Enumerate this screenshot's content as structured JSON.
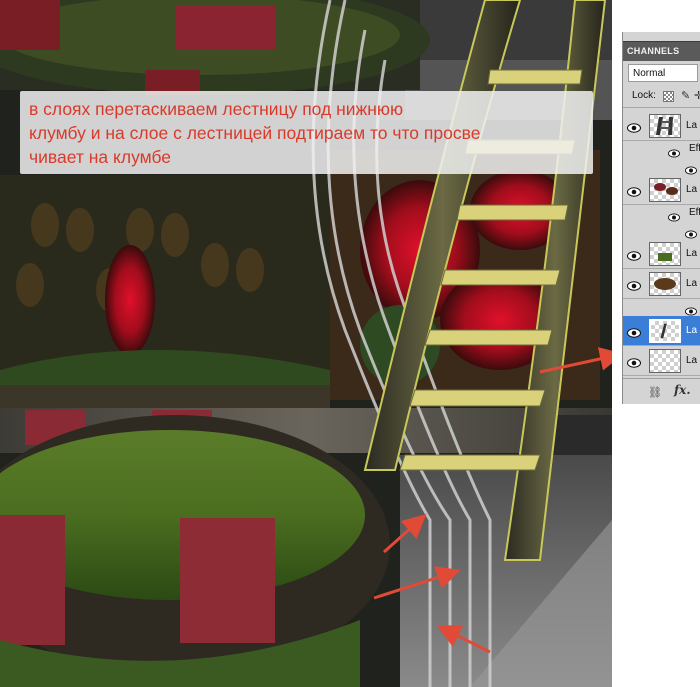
{
  "annotation": {
    "text": "в слоях перетаскиваем лестницу под нижнюю\nклумбу и на слое с лестницей подтираем то что просве\nчивает на клумбе"
  },
  "layers_panel": {
    "tab_label": "CHANNELS",
    "blend_mode": "Normal",
    "lock_label": "Lock:",
    "rows": [
      {
        "kind": "layer",
        "name": "La",
        "visible": true,
        "selected": false,
        "thumb": "ladder"
      },
      {
        "kind": "effects",
        "name": "Effe"
      },
      {
        "kind": "effect-item"
      },
      {
        "kind": "layer",
        "name": "La",
        "visible": true,
        "selected": false,
        "thumb": "flowers"
      },
      {
        "kind": "effects",
        "name": "Effe"
      },
      {
        "kind": "effect-item"
      },
      {
        "kind": "layer",
        "name": "La",
        "visible": true,
        "selected": false,
        "thumb": "grass"
      },
      {
        "kind": "layer",
        "name": "La",
        "visible": true,
        "selected": false,
        "thumb": "bees"
      },
      {
        "kind": "effect-item"
      },
      {
        "kind": "layer",
        "name": "La",
        "visible": true,
        "selected": true,
        "thumb": "ladder-small"
      },
      {
        "kind": "layer",
        "name": "La",
        "visible": true,
        "selected": false,
        "thumb": "empty"
      }
    ],
    "footer_icons": [
      "link-icon",
      "fx-icon"
    ]
  },
  "colors": {
    "annotation_text": "#d93a2a",
    "selection": "#3b7ed8",
    "arrow": "#e04a36"
  }
}
